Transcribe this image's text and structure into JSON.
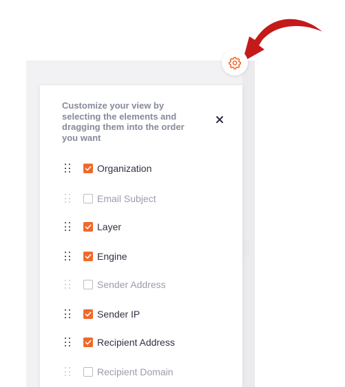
{
  "colors": {
    "accent": "#f0692b",
    "arrow": "#c41a1a",
    "header_text": "#868a9a",
    "label_active": "#2f3342",
    "label_inactive": "#9a9daa"
  },
  "icons": {
    "gear": "gear-icon",
    "close": "close-icon",
    "drag": "drag-handle-icon",
    "check": "checkmark-icon",
    "arrow": "pointer-arrow-icon"
  },
  "panel": {
    "header": "Customize your view by\nselecting the elements and\ndragging them into the order\nyou want",
    "close_label": "×"
  },
  "items": [
    {
      "label": "Organization",
      "checked": true
    },
    {
      "label": "Email Subject",
      "checked": false
    },
    {
      "label": "Layer",
      "checked": true
    },
    {
      "label": "Engine",
      "checked": true
    },
    {
      "label": "Sender Address",
      "checked": false
    },
    {
      "label": "Sender IP",
      "checked": true
    },
    {
      "label": "Recipient Address",
      "checked": true
    },
    {
      "label": "Recipient Domain",
      "checked": false
    }
  ]
}
